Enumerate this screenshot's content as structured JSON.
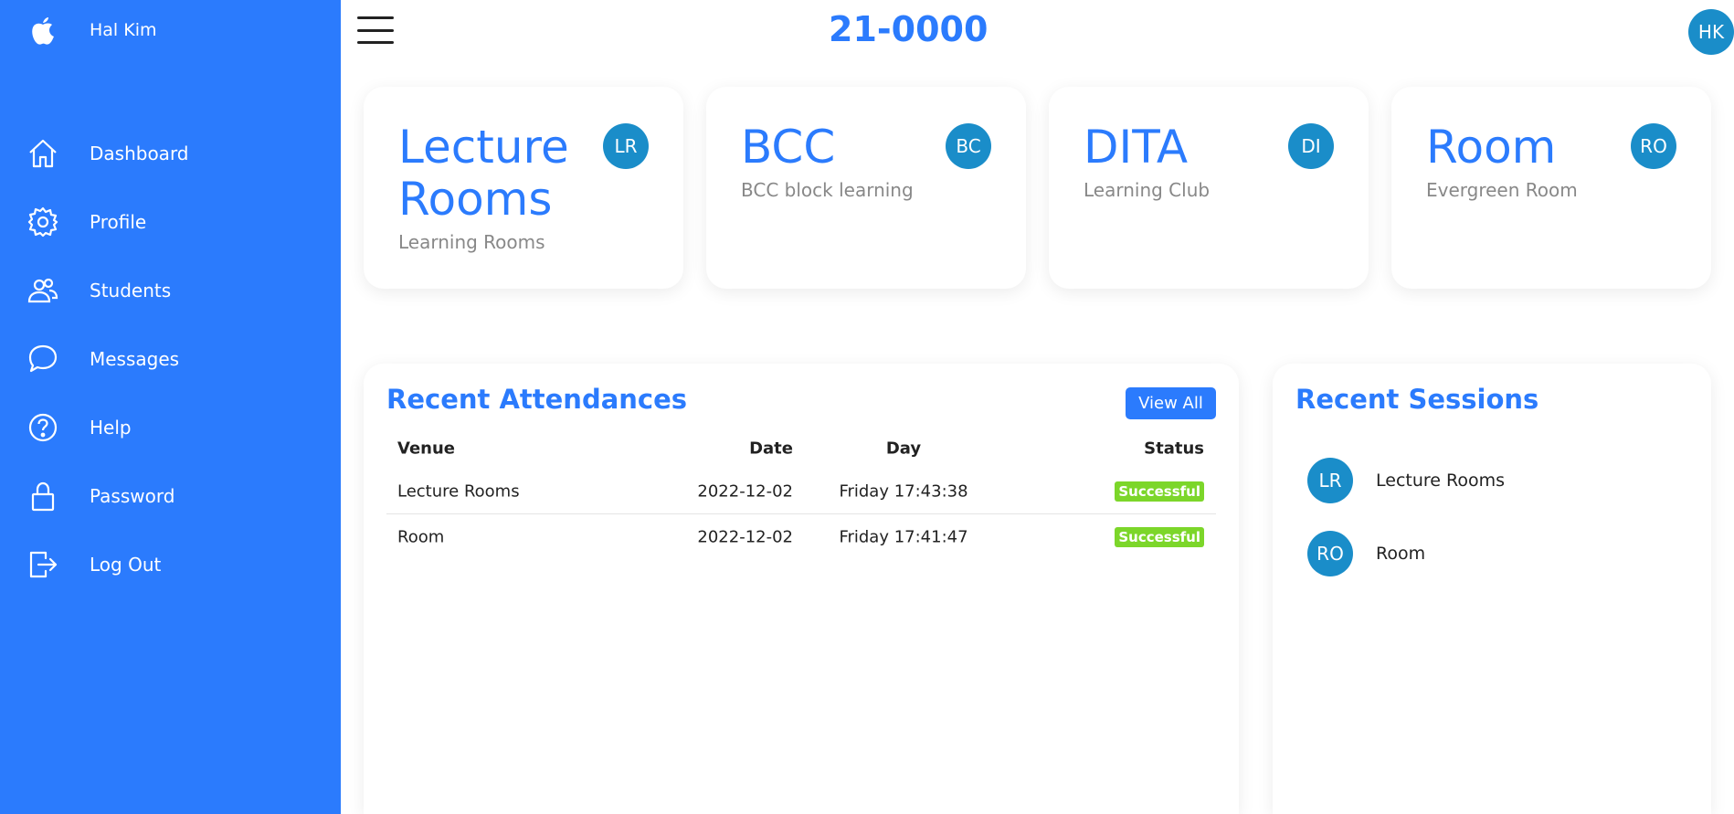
{
  "app": {
    "username": "Hal Kim",
    "page_title": "21-0000",
    "user_initials": "HK"
  },
  "colors": {
    "accent": "#2b7bfd",
    "avatar": "#1a8dc9",
    "success": "#7cd62a",
    "muted_text": "#888888"
  },
  "sidebar": {
    "items": [
      {
        "label": "Dashboard",
        "icon": "home-icon"
      },
      {
        "label": "Profile",
        "icon": "gear-icon"
      },
      {
        "label": "Students",
        "icon": "users-icon"
      },
      {
        "label": "Messages",
        "icon": "chat-bubble-icon"
      },
      {
        "label": "Help",
        "icon": "help-circle-icon"
      },
      {
        "label": "Password",
        "icon": "lock-icon"
      },
      {
        "label": "Log Out",
        "icon": "logout-icon"
      }
    ]
  },
  "cards": [
    {
      "title": "Lecture Rooms",
      "subtitle": "Learning Rooms",
      "initials": "LR"
    },
    {
      "title": "BCC",
      "subtitle": "BCC block learning",
      "initials": "BC"
    },
    {
      "title": "DITA",
      "subtitle": "Learning Club",
      "initials": "DI"
    },
    {
      "title": "Room",
      "subtitle": "Evergreen Room",
      "initials": "RO"
    }
  ],
  "attendances": {
    "title": "Recent Attendances",
    "view_all_label": "View All",
    "columns": {
      "venue": "Venue",
      "date": "Date",
      "day": "Day",
      "status": "Status"
    },
    "rows": [
      {
        "venue": "Lecture Rooms",
        "date": "2022-12-02",
        "day": "Friday 17:43:38",
        "status": "Successful"
      },
      {
        "venue": "Room",
        "date": "2022-12-02",
        "day": "Friday 17:41:47",
        "status": "Successful"
      }
    ]
  },
  "sessions": {
    "title": "Recent Sessions",
    "items": [
      {
        "initials": "LR",
        "label": "Lecture Rooms"
      },
      {
        "initials": "RO",
        "label": "Room"
      }
    ]
  }
}
